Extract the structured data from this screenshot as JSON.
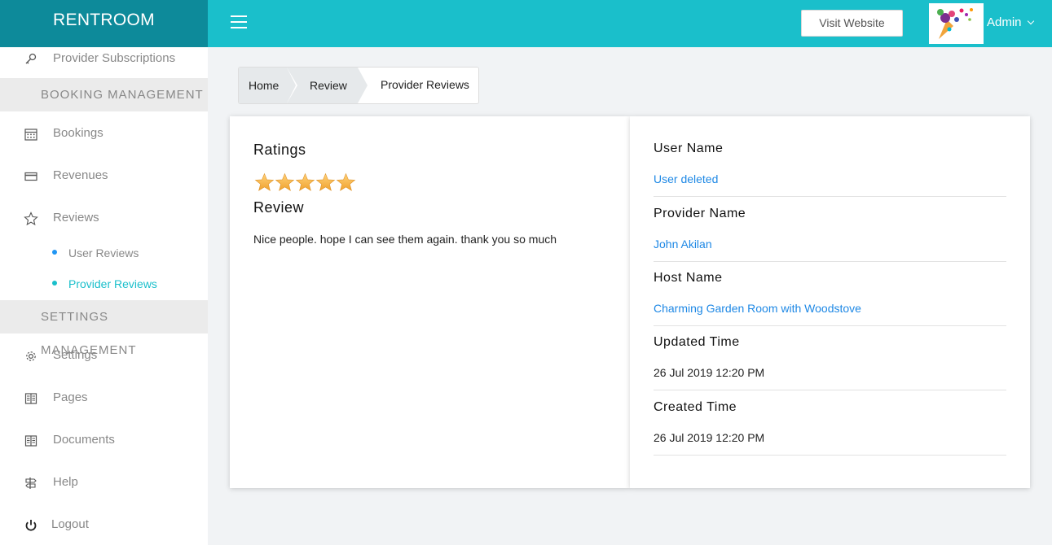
{
  "brand": "RENTROOM",
  "topbar": {
    "visit_label": "Visit Website",
    "admin_label": "Admin"
  },
  "sidebar": {
    "provider_subscriptions": "Provider Subscriptions",
    "booking_section": "BOOKING MANAGEMENT",
    "bookings": "Bookings",
    "revenues": "Revenues",
    "reviews": "Reviews",
    "user_reviews": "User Reviews",
    "provider_reviews": "Provider Reviews",
    "settings_section": "SETTINGS MANAGEMENT",
    "settings": "Settings",
    "pages": "Pages",
    "documents": "Documents",
    "help": "Help",
    "logout": "Logout"
  },
  "breadcrumb": {
    "home": "Home",
    "review": "Review",
    "current": "Provider Reviews"
  },
  "ratings": {
    "title": "Ratings",
    "value": 5,
    "max": 5,
    "star_color": "#f5b133"
  },
  "review": {
    "title": "Review",
    "text": "Nice people. hope I can see them again. thank you so much"
  },
  "details": {
    "user_name_label": "User Name",
    "user_name_value": "User deleted",
    "provider_name_label": "Provider Name",
    "provider_name_value": "John Akilan",
    "host_name_label": "Host Name",
    "host_name_value": "Charming Garden Room with Woodstove",
    "updated_label": "Updated Time",
    "updated_value": "26 Jul 2019 12:20 PM",
    "created_label": "Created Time",
    "created_value": "26 Jul 2019 12:20 PM"
  },
  "colors": {
    "brand_bg": "#0d8a9a",
    "topbar_bg": "#1abfcb",
    "link": "#1e88e5"
  }
}
